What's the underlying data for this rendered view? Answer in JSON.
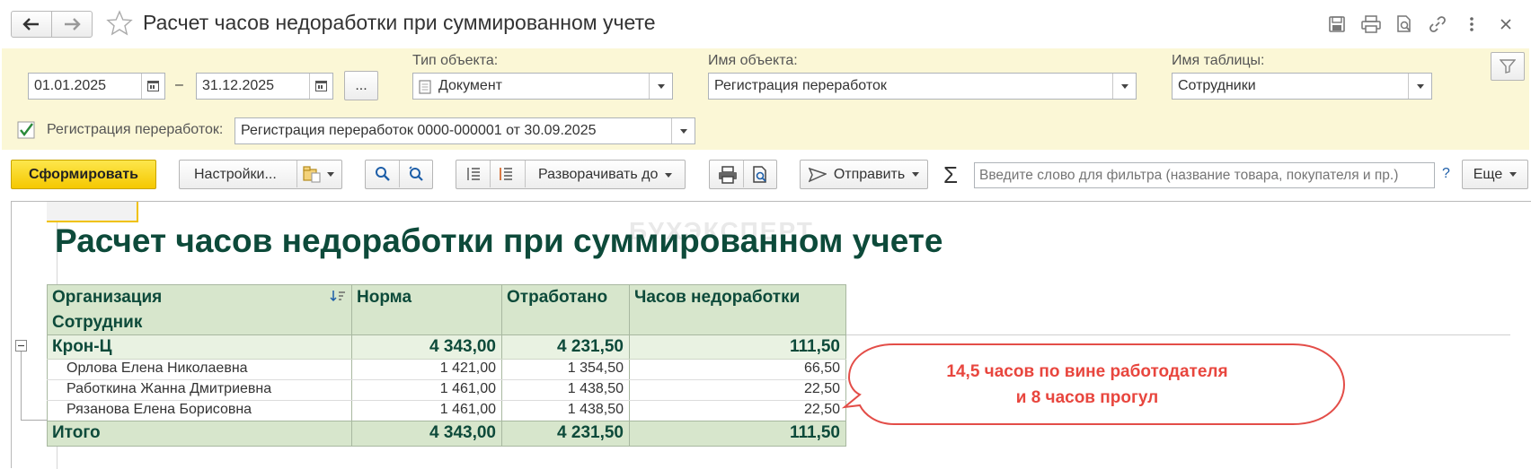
{
  "window": {
    "title": "Расчет часов недоработки при суммированном учете"
  },
  "filters": {
    "date_from": "01.01.2025",
    "date_dash": "–",
    "date_to": "31.12.2025",
    "period_button": "...",
    "object_type_label": "Тип объекта:",
    "object_type_value": "Документ",
    "object_name_label": "Имя объекта:",
    "object_name_value": "Регистрация переработок",
    "table_name_label": "Имя таблицы:",
    "table_name_value": "Сотрудники",
    "registration_label": "Регистрация переработок:",
    "registration_checked": true,
    "registration_value": "Регистрация переработок 0000-000001 от 30.09.2025"
  },
  "toolbar": {
    "generate_label": "Сформировать",
    "settings_label": "Настройки...",
    "expand_label": "Разворачивать до",
    "send_label": "Отправить",
    "filter_placeholder": "Введите слово для фильтра (название товара, покупателя и пр.)",
    "help_label": "?",
    "more_label": "Еще"
  },
  "watermark": "БУХЭКСПЕРТ",
  "report": {
    "title": "Расчет часов недоработки при суммированном учете",
    "headers": {
      "org": "Организация",
      "employee": "Сотрудник",
      "norm": "Норма",
      "worked": "Отработано",
      "shortfall": "Часов недоработки"
    },
    "group": {
      "name": "Крон-Ц",
      "norm": "4 343,00",
      "worked": "4 231,50",
      "shortfall": "111,50"
    },
    "rows": [
      {
        "name": "Орлова Елена Николаевна",
        "norm": "1 421,00",
        "worked": "1 354,50",
        "shortfall": "66,50"
      },
      {
        "name": "Работкина Жанна Дмитриевна",
        "norm": "1 461,00",
        "worked": "1 438,50",
        "shortfall": "22,50"
      },
      {
        "name": "Рязанова Елена Борисовна",
        "norm": "1 461,00",
        "worked": "1 438,50",
        "shortfall": "22,50"
      }
    ],
    "total": {
      "label": "Итого",
      "norm": "4 343,00",
      "worked": "4 231,50",
      "shortfall": "111,50"
    }
  },
  "callout": {
    "line1": "14,5 часов по вине работодателя",
    "line2": "и 8 часов прогул",
    "color": "#e8463e"
  },
  "colors": {
    "panel_bg": "#fbf7d6",
    "primary_button": "#f5c800",
    "report_header_bg": "#d7e6cc",
    "report_text": "#0d4a3a"
  }
}
